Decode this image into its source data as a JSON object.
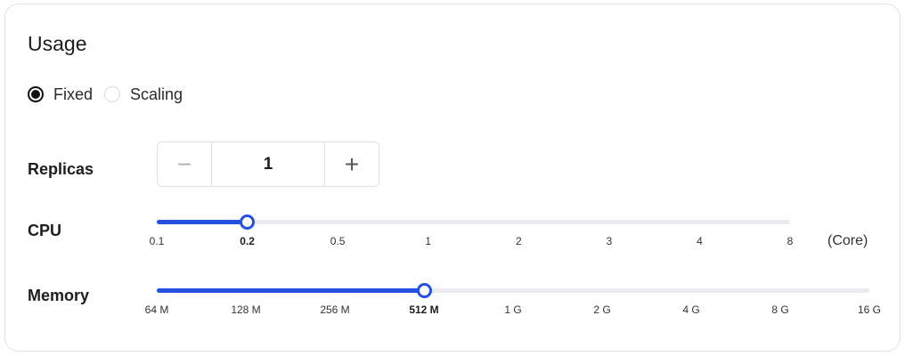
{
  "title": "Usage",
  "mode": {
    "options": [
      {
        "label": "Fixed",
        "checked": true
      },
      {
        "label": "Scaling",
        "checked": false
      }
    ]
  },
  "replicas": {
    "label": "Replicas",
    "value": "1",
    "minus_icon": "minus-icon",
    "plus_icon": "plus-icon"
  },
  "cpu": {
    "label": "CPU",
    "marks": [
      "0.1",
      "0.2",
      "0.5",
      "1",
      "2",
      "3",
      "4",
      "8"
    ],
    "selected": "0.2",
    "unit": "(Core)"
  },
  "memory": {
    "label": "Memory",
    "marks": [
      "64 M",
      "128 M",
      "256 M",
      "512 M",
      "1 G",
      "2 G",
      "4 G",
      "8 G",
      "16 G"
    ],
    "selected": "512 M"
  },
  "colors": {
    "accent": "#2452e0",
    "rail": "#e8eaef",
    "radio_checked": "#111111"
  }
}
